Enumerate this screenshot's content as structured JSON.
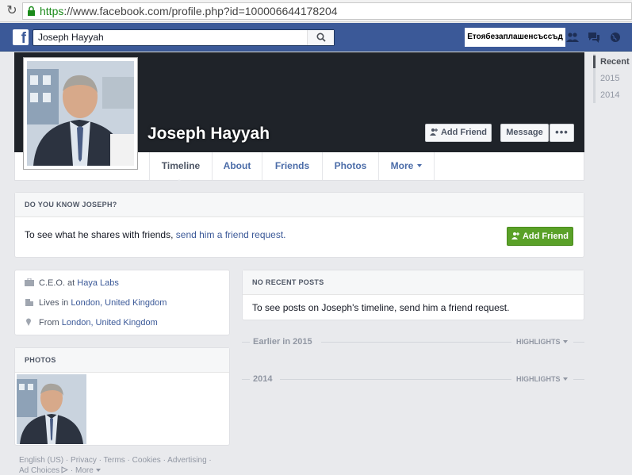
{
  "browser": {
    "url_scheme": "https",
    "url_rest": "://www.facebook.com/profile.php?id=100006644178204",
    "reload_icon": "reload-icon",
    "lock_icon": "lock-icon"
  },
  "topbar": {
    "logo_letter": "f",
    "search_value": "Joseph Hayyah",
    "signup_label": "Етоябезаплашенсъссъд",
    "icons": [
      "friend-requests-icon",
      "messages-icon",
      "notifications-globe-icon"
    ],
    "brand_color": "#3b5998"
  },
  "year_nav": {
    "items": [
      "Recent",
      "2015",
      "2014"
    ]
  },
  "profile": {
    "name": "Joseph Hayyah",
    "add_friend_label": "Add Friend",
    "message_label": "Message",
    "more_label": "•••"
  },
  "tabs": [
    {
      "label": "Timeline"
    },
    {
      "label": "About"
    },
    {
      "label": "Friends"
    },
    {
      "label": "Photos"
    },
    {
      "label": "More"
    }
  ],
  "know_card": {
    "heading": "DO YOU KNOW JOSEPH?",
    "text_prefix": "To see what he shares with friends, ",
    "link_text": "send him a friend request.",
    "button_label": "Add Friend",
    "button_color": "#5aa128"
  },
  "intro": {
    "work_prefix": "C.E.O. at ",
    "work_link": "Haya Labs",
    "lives_prefix": "Lives in ",
    "lives_link": "London, United Kingdom",
    "from_prefix": "From ",
    "from_link": "London, United Kingdom"
  },
  "photos_card": {
    "heading": "PHOTOS"
  },
  "posts_card": {
    "heading": "NO RECENT POSTS",
    "text": "To see posts on Joseph's timeline, send him a friend request."
  },
  "sections": [
    {
      "title": "Earlier in 2015",
      "highlights": "HIGHLIGHTS"
    },
    {
      "title": "2014",
      "highlights": "HIGHLIGHTS"
    }
  ],
  "footer": {
    "links": [
      "English (US)",
      "Privacy",
      "Terms",
      "Cookies",
      "Advertising",
      "Ad Choices",
      "More"
    ],
    "separator": " · "
  }
}
